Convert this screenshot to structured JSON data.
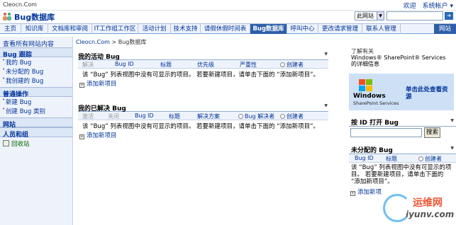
{
  "topbar": {
    "site_url": "Cleocn.Com",
    "welcome": "欢迎",
    "system_account": "系统帐户 ▾"
  },
  "header": {
    "site_title": "Bug数据库",
    "scope_value": "此网站",
    "search_placeholder": "",
    "search_go_icon": "arrow-right-icon"
  },
  "tabs": [
    {
      "label": "主页"
    },
    {
      "label": "知识库"
    },
    {
      "label": "文档库和审阅"
    },
    {
      "label": "IT工作组工作区"
    },
    {
      "label": "活动计划"
    },
    {
      "label": "技术支持"
    },
    {
      "label": "请假休假时间表"
    },
    {
      "label": "Bug数据库",
      "active": true
    },
    {
      "label": "呼叫中心"
    },
    {
      "label": "更改请求管理"
    },
    {
      "label": "联系人管理"
    },
    {
      "label": "网站"
    }
  ],
  "leftnav": {
    "view_all": "查看所有网站内容",
    "groups": [
      {
        "title": "Bug 跟踪",
        "items": [
          "我的 Bug",
          "未分配的 Bug",
          "我创建的 Bug"
        ]
      },
      {
        "title": "普通操作",
        "items": [
          "新建 Bug",
          "创建 Bug 类别"
        ]
      }
    ],
    "sites": "网站",
    "people": "人员和组",
    "recycle": "回收站"
  },
  "breadcrumb": {
    "root": "Cleocn.Com",
    "sep": " > ",
    "current": "Bug数据库"
  },
  "my_active": {
    "title": "我的活动  Bug",
    "columns": [
      "解决",
      "Bug ID",
      "标题",
      "优先级",
      "严重性",
      "创建者"
    ],
    "empty": "该 “Bug” 列表视图中没有可显示的项目。 若要新建项目，请单击下面的 “添加新项目”。",
    "add_new": "添加新项目"
  },
  "my_resolved": {
    "title": "我的已解决  Bug",
    "columns": [
      "激活",
      "关闭",
      "Bug ID",
      "标题",
      "解决方案",
      "Bug 解决者",
      "创建者"
    ],
    "empty": "该 “Bug” 列表视图中没有可显示的项目。 若要新建项目，请单击下面的 “添加新项目”。",
    "add_new": "添加新项目"
  },
  "right": {
    "learn_title": "了解有关",
    "learn_line2": "Windows® SharePoint® Services",
    "learn_line3": "的详细信息",
    "promo_brand": "Windows",
    "promo_sub": "SharePoint Services",
    "promo_link": "单击此处查看资源",
    "open_by_id_title": "按 ID 打开 Bug",
    "search_button": "搜索",
    "unassigned_title": "未分配的 Bug",
    "unassigned_columns": [
      "Bug ID",
      "标题",
      "创建者"
    ],
    "unassigned_empty": "该 “Bug” 列表视图中没有可显示的项目。 若要新建项目，请单击下面的 “添加新项目”。",
    "add_new": "添加新项"
  },
  "watermark": {
    "text1": "运维网",
    "text2": "iyunv.com"
  }
}
